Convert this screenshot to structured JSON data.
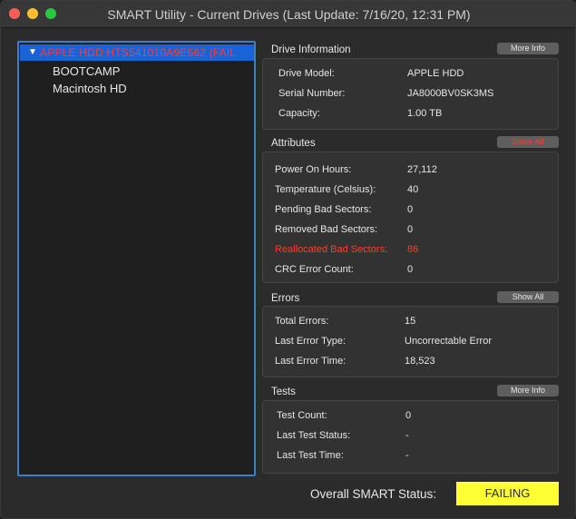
{
  "window": {
    "title": "SMART Utility - Current Drives (Last Update: 7/16/20, 12:31 PM)"
  },
  "drives": {
    "selected_drive_label": "APPLE HDD HTS541010A9E662  (FAIL",
    "disclosure_glyph": "▼",
    "volumes": [
      "BOOTCAMP",
      "Macintosh HD"
    ]
  },
  "drive_info": {
    "title": "Drive Information",
    "button": "More Info",
    "rows": [
      {
        "label": "Drive Model:",
        "value": "APPLE HDD"
      },
      {
        "label": "Serial Number:",
        "value": "JA8000BV0SK3MS"
      },
      {
        "label": "Capacity:",
        "value": "1.00 TB"
      }
    ]
  },
  "attributes": {
    "title": "Attributes",
    "button": "Show All",
    "rows": [
      {
        "label": "Power On Hours:",
        "value": "27,112"
      },
      {
        "label": "Temperature (Celsius):",
        "value": "40"
      },
      {
        "label": "Pending Bad Sectors:",
        "value": "0"
      },
      {
        "label": "Removed Bad Sectors:",
        "value": "0"
      },
      {
        "label": "Reallocated Bad Sectors:",
        "value": "86"
      },
      {
        "label": "CRC Error Count:",
        "value": "0"
      }
    ]
  },
  "errors": {
    "title": "Errors",
    "button": "Show All",
    "rows": [
      {
        "label": "Total Errors:",
        "value": "15"
      },
      {
        "label": "Last Error Type:",
        "value": "Uncorrectable Error"
      },
      {
        "label": "Last Error Time:",
        "value": "18,523"
      }
    ]
  },
  "tests": {
    "title": "Tests",
    "button": "More Info",
    "rows": [
      {
        "label": "Test Count:",
        "value": "0"
      },
      {
        "label": "Last Test Status:",
        "value": "-"
      },
      {
        "label": "Last Test Time:",
        "value": "-"
      }
    ]
  },
  "overall": {
    "label": "Overall SMART Status:",
    "status": "FAILING"
  },
  "colors": {
    "alert": "#ff3b30",
    "selection": "#1a62d6",
    "status_badge": "#ffff33"
  }
}
